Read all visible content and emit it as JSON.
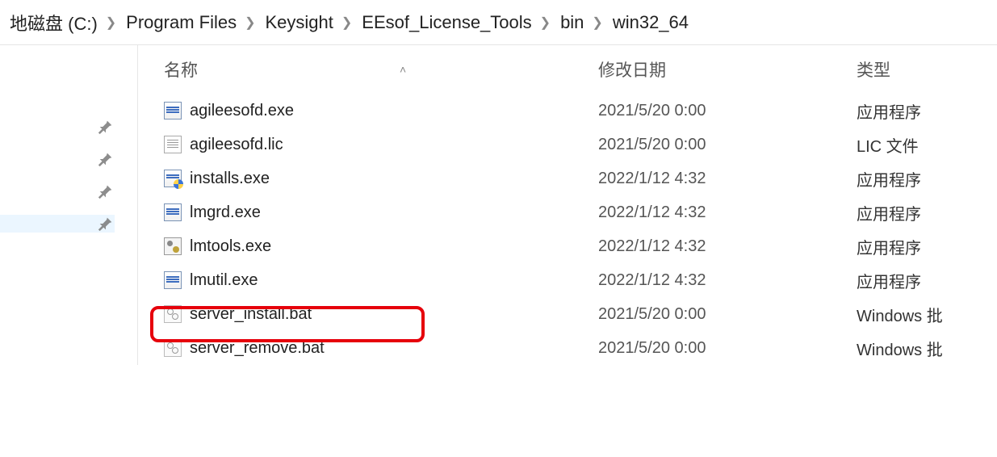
{
  "breadcrumb": [
    "地磁盘 (C:)",
    "Program Files",
    "Keysight",
    "EEsof_License_Tools",
    "bin",
    "win32_64"
  ],
  "columns": {
    "name": "名称",
    "date": "修改日期",
    "type": "类型"
  },
  "files": [
    {
      "icon": "app",
      "name": "agileesofd.exe",
      "date": "2021/5/20 0:00",
      "type": "应用程序"
    },
    {
      "icon": "lic",
      "name": "agileesofd.lic",
      "date": "2021/5/20 0:00",
      "type": "LIC 文件"
    },
    {
      "icon": "appshield",
      "name": "installs.exe",
      "date": "2022/1/12 4:32",
      "type": "应用程序"
    },
    {
      "icon": "app",
      "name": "lmgrd.exe",
      "date": "2022/1/12 4:32",
      "type": "应用程序"
    },
    {
      "icon": "tool",
      "name": "lmtools.exe",
      "date": "2022/1/12 4:32",
      "type": "应用程序"
    },
    {
      "icon": "app",
      "name": "lmutil.exe",
      "date": "2022/1/12 4:32",
      "type": "应用程序"
    },
    {
      "icon": "bat",
      "name": "server_install.bat",
      "date": "2021/5/20 0:00",
      "type": "Windows 批"
    },
    {
      "icon": "bat",
      "name": "server_remove.bat",
      "date": "2021/5/20 0:00",
      "type": "Windows 批"
    }
  ],
  "highlight_index": 6
}
